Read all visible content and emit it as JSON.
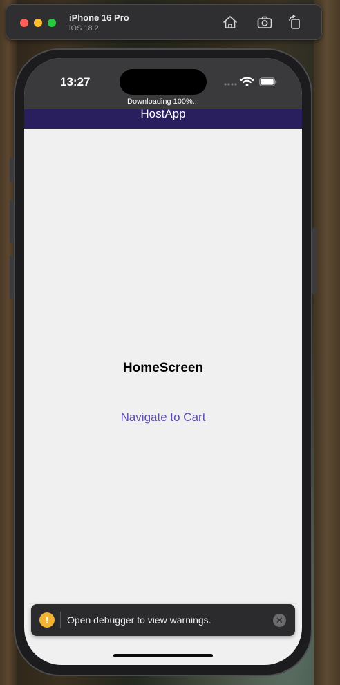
{
  "simulator": {
    "device_name": "iPhone 16 Pro",
    "os_version": "iOS 18.2",
    "toolbar_icons": [
      "home-icon",
      "screenshot-icon",
      "rotate-icon"
    ]
  },
  "status_bar": {
    "time": "13:27",
    "icons": [
      "cellular-dots-icon",
      "wifi-icon",
      "battery-icon"
    ]
  },
  "app": {
    "downloading_text": "Downloading 100%...",
    "header_title": "HostApp",
    "heading": "HomeScreen",
    "nav_link": "Navigate to Cart"
  },
  "toast": {
    "message": "Open debugger to view warnings.",
    "icon": "warning-icon",
    "close_icon": "close-icon"
  },
  "colors": {
    "header_bg": "#2a1f5e",
    "link": "#5b4fa8",
    "warning": "#f2b233",
    "screen_bg": "#f0f0f0"
  }
}
